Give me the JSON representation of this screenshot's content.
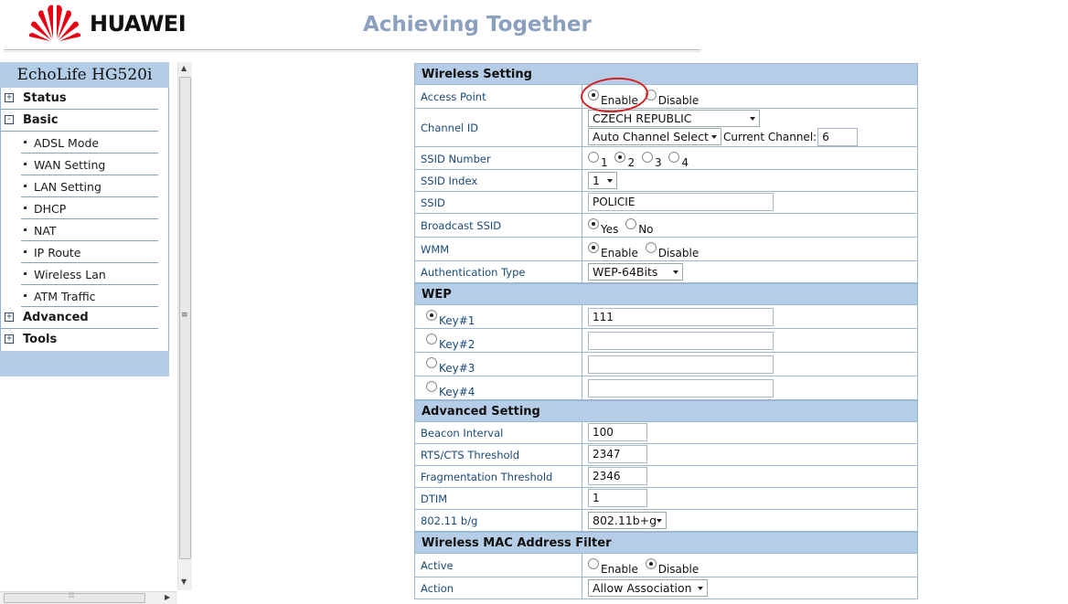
{
  "header": {
    "brand": "HUAWEI",
    "slogan": "Achieving Together"
  },
  "sidebar": {
    "device_title": "EchoLife HG520i",
    "top_items": [
      {
        "label": "Status",
        "expand": "+"
      },
      {
        "label": "Basic",
        "expand": "-"
      },
      {
        "label": "Advanced",
        "expand": "+"
      },
      {
        "label": "Tools",
        "expand": "+"
      }
    ],
    "basic_items": [
      "ADSL Mode",
      "WAN Setting",
      "LAN Setting",
      "DHCP",
      "NAT",
      "IP Route",
      "Wireless Lan",
      "ATM Traffic"
    ]
  },
  "wireless": {
    "section_title": "Wireless Setting",
    "access_point": {
      "label": "Access Point",
      "enable": "Enable",
      "disable": "Disable",
      "selected": "enable"
    },
    "channel_id": {
      "label": "Channel ID",
      "country": "CZECH REPUBLIC",
      "channel_select": "Auto Channel Select",
      "current_label": "Current Channel:",
      "current_value": "6"
    },
    "ssid_number": {
      "label": "SSID Number",
      "options": [
        "1",
        "2",
        "3",
        "4"
      ],
      "selected": "2"
    },
    "ssid_index": {
      "label": "SSID Index",
      "value": "1"
    },
    "ssid": {
      "label": "SSID",
      "value": "POLICIE"
    },
    "broadcast_ssid": {
      "label": "Broadcast SSID",
      "yes": "Yes",
      "no": "No",
      "selected": "yes"
    },
    "wmm": {
      "label": "WMM",
      "enable": "Enable",
      "disable": "Disable",
      "selected": "enable"
    },
    "auth_type": {
      "label": "Authentication Type",
      "value": "WEP-64Bits"
    }
  },
  "wep": {
    "section_title": "WEP",
    "keys": [
      {
        "label": "Key#1",
        "value": "111",
        "selected": true
      },
      {
        "label": "Key#2",
        "value": "",
        "selected": false
      },
      {
        "label": "Key#3",
        "value": "",
        "selected": false
      },
      {
        "label": "Key#4",
        "value": "",
        "selected": false
      }
    ]
  },
  "advanced": {
    "section_title": "Advanced Setting",
    "beacon_interval": {
      "label": "Beacon Interval",
      "value": "100"
    },
    "rts_cts": {
      "label": "RTS/CTS Threshold",
      "value": "2347"
    },
    "fragmentation": {
      "label": "Fragmentation Threshold",
      "value": "2346"
    },
    "dtim": {
      "label": "DTIM",
      "value": "1"
    },
    "mode": {
      "label": "802.11 b/g",
      "value": "802.11b+g"
    }
  },
  "mac_filter": {
    "section_title": "Wireless MAC Address Filter",
    "active": {
      "label": "Active",
      "enable": "Enable",
      "disable": "Disable",
      "selected": "disable"
    },
    "action": {
      "label": "Action",
      "value": "Allow Association"
    }
  },
  "colors": {
    "section_bg": "#b5cde6",
    "annotation": "#d42020"
  }
}
